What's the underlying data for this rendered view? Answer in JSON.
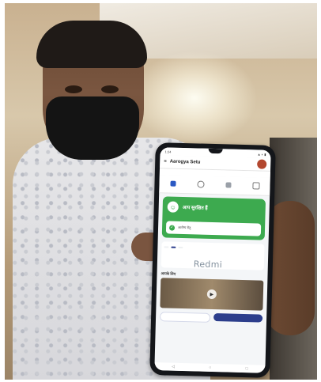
{
  "phone": {
    "status_left": "1:24",
    "status_right": "▲ ◐ ▮",
    "app_title": "Aarogya Setu",
    "tip_text": "",
    "quick_nav": [
      {
        "label": "",
        "icon": "heart-icon",
        "color": "#2b59c3"
      },
      {
        "label": "",
        "icon": "target-icon",
        "color": "#7a7a7a"
      },
      {
        "label": "",
        "icon": "people-icon",
        "color": "#7a7a7a"
      },
      {
        "label": "",
        "icon": "card-icon",
        "color": "#7a7a7a"
      }
    ],
    "status_card": {
      "avatar_symbol": "☺",
      "headline": "आप सुरक्षित हैं",
      "inner_text": "आरोग्य सेतु"
    },
    "brand_watermark": "Redmi",
    "news_tabs": [
      "",
      "",
      ""
    ],
    "section_title": "आपके लिए",
    "action_left": "",
    "action_right": "",
    "navbar_icons": [
      "◁",
      "○",
      "□"
    ]
  },
  "colors": {
    "status_green": "#3daa4f",
    "primary_blue": "#2c3e8c"
  }
}
